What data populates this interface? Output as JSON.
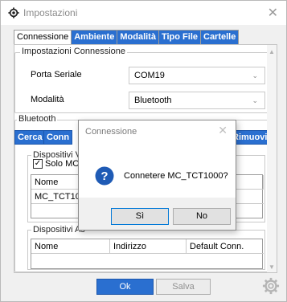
{
  "window": {
    "title": "Impostazioni",
    "close_glyph": "✕",
    "icon": "gear-icon"
  },
  "tabs": [
    {
      "label": "Connessione",
      "active": true
    },
    {
      "label": "Ambiente",
      "active": false
    },
    {
      "label": "Modalità",
      "active": false
    },
    {
      "label": "Tipo File",
      "active": false
    },
    {
      "label": "Cartelle",
      "active": false
    }
  ],
  "connection": {
    "legend": "Impostazioni Connessione",
    "serial_port_label": "Porta Seriale",
    "serial_port_value": "COM19",
    "mode_label": "Modalità",
    "mode_value": "Bluetooth"
  },
  "bluetooth": {
    "legend": "Bluetooth",
    "search_label": "Cerca",
    "connect_label": "Conn",
    "remove_label": "Rimuovi",
    "visible": {
      "legend": "Dispositivi Vi",
      "only_label": "Solo MC4",
      "column_name": "Nome",
      "rows": [
        "MC_TCT100"
      ]
    },
    "associated": {
      "legend": "Dispositivi As",
      "columns": [
        "Nome",
        "Indirizzo",
        "Default Conn."
      ]
    }
  },
  "footer": {
    "ok_label": "Ok",
    "save_label": "Salva"
  },
  "dialog": {
    "title": "Connessione",
    "close_glyph": "✕",
    "message": "Connetere MC_TCT1000?",
    "yes_label": "Sì",
    "no_label": "No"
  },
  "colors": {
    "accent": "#2a6fd0",
    "question_icon": "#1f5bb5"
  }
}
